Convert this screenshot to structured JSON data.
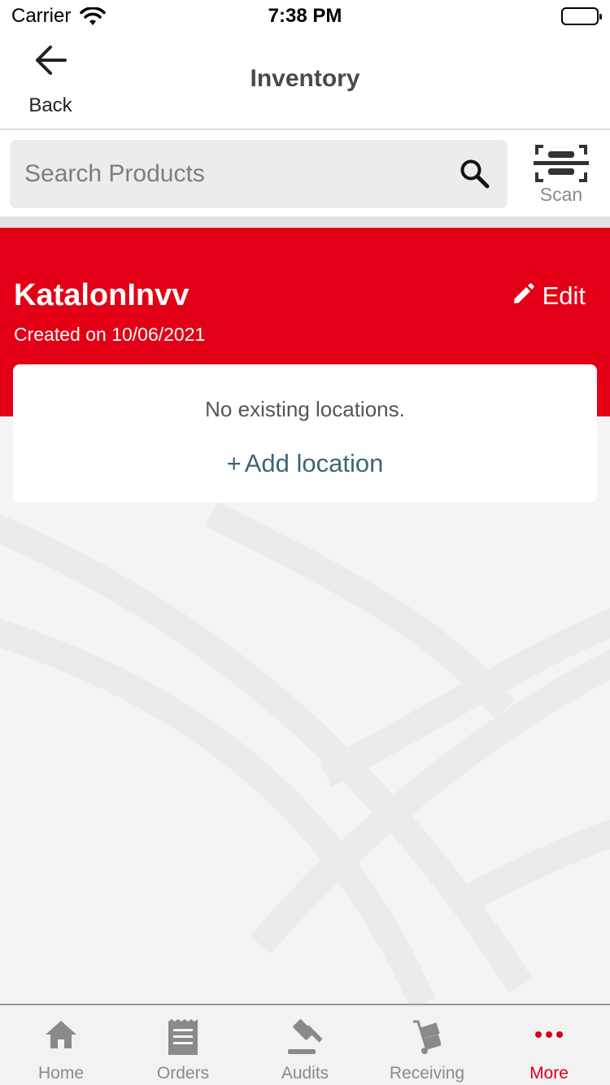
{
  "status_bar": {
    "carrier": "Carrier",
    "time": "7:38 PM"
  },
  "header": {
    "back_label": "Back",
    "title": "Inventory"
  },
  "search": {
    "placeholder": "Search Products",
    "scan_label": "Scan"
  },
  "inventory": {
    "name": "KatalonInvv",
    "created": "Created on 10/06/2021",
    "edit_label": "Edit"
  },
  "locations": {
    "empty_message": "No existing locations.",
    "add_plus": "+",
    "add_label": "Add location"
  },
  "tabs": [
    {
      "label": "Home",
      "icon": "home-icon"
    },
    {
      "label": "Orders",
      "icon": "receipt-icon"
    },
    {
      "label": "Audits",
      "icon": "gavel-icon"
    },
    {
      "label": "Receiving",
      "icon": "hand-truck-icon"
    },
    {
      "label": "More",
      "icon": "more-dots-icon"
    }
  ],
  "active_tab": "More",
  "colors": {
    "brand_red": "#e30016",
    "active_tab": "#d50019",
    "link_teal": "#3d6577"
  }
}
